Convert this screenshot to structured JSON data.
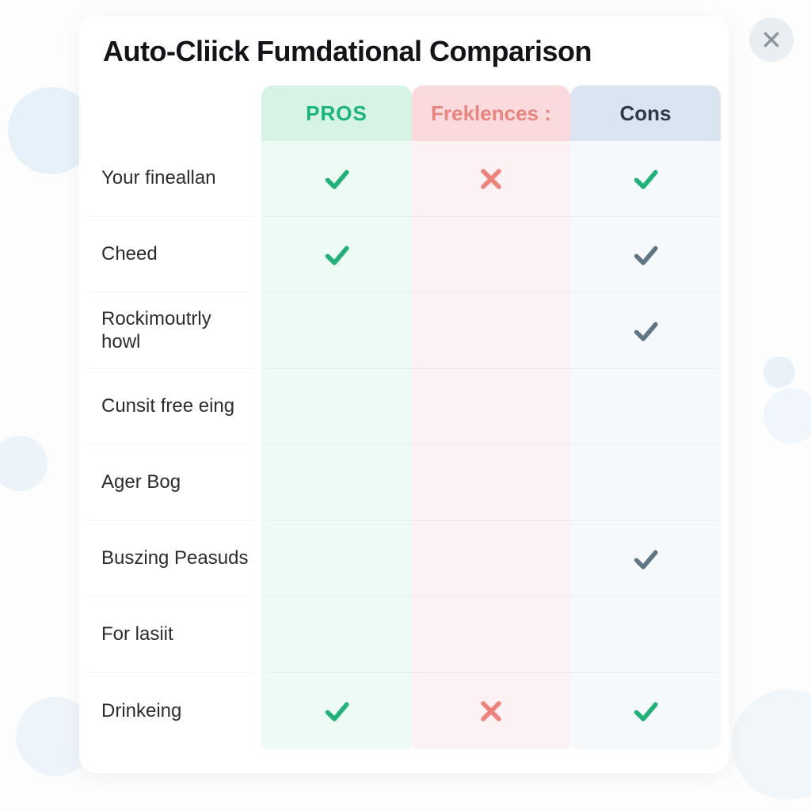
{
  "title": "Auto-Cliick Fumdational Comparison",
  "columns": {
    "pros": "PROS",
    "frek": "Freklences :",
    "cons": "Cons"
  },
  "icons": {
    "check_green": "check-green",
    "check_slate": "check-slate",
    "cross_red": "cross-red"
  },
  "rows": [
    {
      "label": "Your fineallan",
      "pros": "check_green",
      "frek": "cross_red",
      "cons": "check_green"
    },
    {
      "label": "Cheed",
      "pros": "check_green",
      "frek": "",
      "cons": "check_slate"
    },
    {
      "label": "Rockimoutrly howl",
      "pros": "",
      "frek": "",
      "cons": "check_slate"
    },
    {
      "label": "Cunsit free eing",
      "pros": "",
      "frek": "",
      "cons": ""
    },
    {
      "label": "Ager Bog",
      "pros": "",
      "frek": "",
      "cons": ""
    },
    {
      "label": "Buszing Peasuds",
      "pros": "",
      "frek": "",
      "cons": "check_slate"
    },
    {
      "label": "For lasiit",
      "pros": "",
      "frek": "",
      "cons": ""
    },
    {
      "label": "Drinkeing",
      "pros": "check_green",
      "frek": "cross_red",
      "cons": "check_green"
    }
  ]
}
